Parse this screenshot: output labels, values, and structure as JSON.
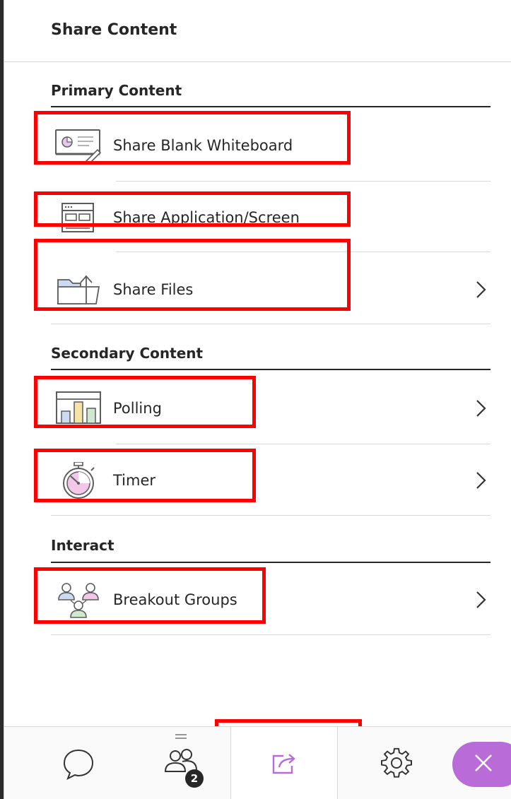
{
  "header": {
    "title": "Share Content"
  },
  "sections": {
    "primary": {
      "title": "Primary Content",
      "items": [
        {
          "label": "Share Blank Whiteboard",
          "icon": "whiteboard-icon",
          "has_chevron": false
        },
        {
          "label": "Share Application/Screen",
          "icon": "application-window-icon",
          "has_chevron": false
        },
        {
          "label": "Share Files",
          "icon": "folder-upload-icon",
          "has_chevron": true
        }
      ]
    },
    "secondary": {
      "title": "Secondary Content",
      "items": [
        {
          "label": "Polling",
          "icon": "poll-chart-icon",
          "has_chevron": true
        },
        {
          "label": "Timer",
          "icon": "stopwatch-icon",
          "has_chevron": true
        }
      ]
    },
    "interact": {
      "title": "Interact",
      "items": [
        {
          "label": "Breakout Groups",
          "icon": "breakout-groups-icon",
          "has_chevron": true
        }
      ]
    }
  },
  "toolbar": {
    "items": [
      {
        "name": "chat",
        "icon": "chat-bubble-icon"
      },
      {
        "name": "attendees",
        "icon": "attendees-icon",
        "badge": "2"
      },
      {
        "name": "share-content",
        "icon": "share-content-icon",
        "active": true
      },
      {
        "name": "settings",
        "icon": "gear-icon"
      },
      {
        "name": "close",
        "icon": "close-icon"
      }
    ]
  },
  "colors": {
    "accent": "#b96bd8",
    "highlight": "#ff0000",
    "text": "#262626",
    "divider": "#d9d9d9"
  }
}
